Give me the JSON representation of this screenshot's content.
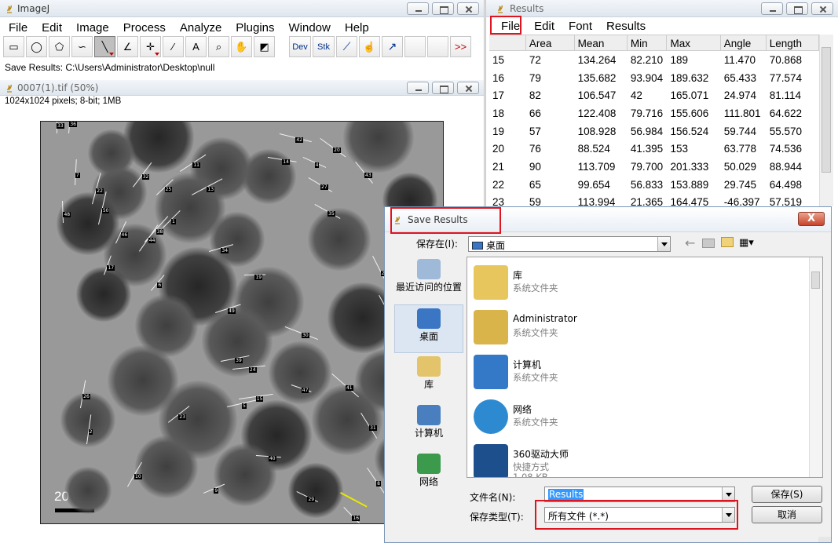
{
  "imagej": {
    "title": "ImageJ",
    "menu": [
      "File",
      "Edit",
      "Image",
      "Process",
      "Analyze",
      "Plugins",
      "Window",
      "Help"
    ],
    "tools": [
      {
        "name": "rectangle-tool-icon",
        "glyph": "▭"
      },
      {
        "name": "oval-tool-icon",
        "glyph": "◯"
      },
      {
        "name": "polygon-tool-icon",
        "glyph": "⬠"
      },
      {
        "name": "freehand-tool-icon",
        "glyph": "∽"
      },
      {
        "name": "line-tool-icon",
        "glyph": "╲"
      },
      {
        "name": "angle-tool-icon",
        "glyph": "∠"
      },
      {
        "name": "point-tool-icon",
        "glyph": "✛"
      },
      {
        "name": "wand-tool-icon",
        "glyph": "⁄"
      },
      {
        "name": "text-tool-icon",
        "glyph": "A"
      },
      {
        "name": "magnifier-tool-icon",
        "glyph": "⌕"
      },
      {
        "name": "hand-tool-icon",
        "glyph": "✋"
      },
      {
        "name": "color-picker-tool-icon",
        "glyph": "◩"
      }
    ],
    "dev_label": "Dev",
    "stk_label": "Stk",
    "more_label": ">>",
    "status": "Save Results: C:\\Users\\Administrator\\Desktop\\null"
  },
  "image_window": {
    "title": "0007(1).tif (50%)",
    "info": "1024x1024 pixels; 8-bit; 1MB",
    "scale_label": "20 nm"
  },
  "results": {
    "title": "Results",
    "menu": [
      "File",
      "Edit",
      "Font",
      "Results"
    ],
    "columns": [
      "",
      "Area",
      "Mean",
      "Min",
      "Max",
      "Angle",
      "Length"
    ],
    "rows": [
      [
        "15",
        "72",
        "134.264",
        "82.210",
        "189",
        "11.470",
        "70.868"
      ],
      [
        "16",
        "79",
        "135.682",
        "93.904",
        "189.632",
        "65.433",
        "77.574"
      ],
      [
        "17",
        "82",
        "106.547",
        "42",
        "165.071",
        "24.974",
        "81.114"
      ],
      [
        "18",
        "66",
        "122.408",
        "79.716",
        "155.606",
        "111.801",
        "64.622"
      ],
      [
        "19",
        "57",
        "108.928",
        "56.984",
        "156.524",
        "59.744",
        "55.570"
      ],
      [
        "20",
        "76",
        "88.524",
        "41.395",
        "153",
        "63.778",
        "74.536"
      ],
      [
        "21",
        "90",
        "113.709",
        "79.700",
        "201.333",
        "50.029",
        "88.944"
      ],
      [
        "22",
        "65",
        "99.654",
        "56.833",
        "153.889",
        "29.745",
        "64.498"
      ],
      [
        "23",
        "59",
        "113.994",
        "21.365",
        "164.475",
        "-46.397",
        "57.519"
      ]
    ]
  },
  "save_dialog": {
    "title": "Save Results",
    "save_in_label": "保存在(I):",
    "save_in_value": "桌面",
    "places": [
      "最近访问的位置",
      "桌面",
      "库",
      "计算机",
      "网络"
    ],
    "files": [
      {
        "name": "库",
        "type": "系统文件夹",
        "size": ""
      },
      {
        "name": "Administrator",
        "type": "系统文件夹",
        "size": ""
      },
      {
        "name": "计算机",
        "type": "系统文件夹",
        "size": ""
      },
      {
        "name": "网络",
        "type": "系统文件夹",
        "size": ""
      },
      {
        "name": "360驱动大师",
        "type": "快捷方式",
        "size": "1.08 KB"
      }
    ],
    "filename_label": "文件名(N):",
    "filename_value": "Results",
    "filetype_label": "保存类型(T):",
    "filetype_value": "所有文件 (*.*)",
    "save_button": "保存(S)",
    "cancel_button": "取消",
    "close_symbol": "X"
  },
  "particle_labels": [
    "33",
    "32",
    "34",
    "30",
    "31",
    "36",
    "38",
    "39",
    "29",
    "28",
    "26",
    "25",
    "24",
    "27",
    "21",
    "22",
    "23",
    "19",
    "20",
    "18",
    "17",
    "11",
    "40",
    "41",
    "45",
    "46",
    "13",
    "14",
    "16",
    "12",
    "10",
    "9",
    "42",
    "43",
    "48",
    "44",
    "49",
    "47",
    "8",
    "7",
    "6",
    "5",
    "4",
    "3",
    "2",
    "1",
    "15",
    "35",
    "37",
    "50"
  ]
}
